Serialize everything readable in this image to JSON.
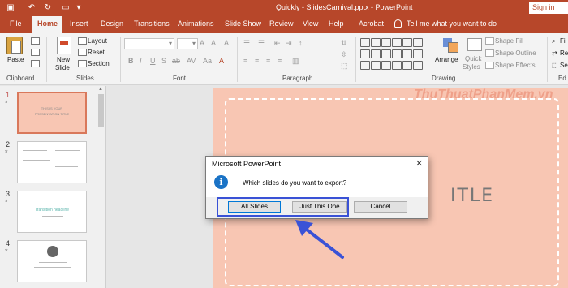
{
  "titlebar": {
    "doc_title": "Quickly - SlidesCarnival.pptx  -  PowerPoint",
    "sign_in": "Sign in",
    "accent_color": "#b7472a"
  },
  "tabs": [
    "File",
    "Home",
    "Insert",
    "Design",
    "Transitions",
    "Animations",
    "Slide Show",
    "Review",
    "View",
    "Help",
    "Acrobat"
  ],
  "tell_me": "Tell me what you want to do",
  "ribbon": {
    "paste": "Paste",
    "new_slide_1": "New",
    "new_slide_2": "Slide",
    "layout": "Layout",
    "reset": "Reset",
    "section": "Section",
    "arrange": "Arrange",
    "quick_styles_1": "Quick",
    "quick_styles_2": "Styles",
    "shape_fill": "Shape Fill",
    "shape_outline": "Shape Outline",
    "shape_effects": "Shape Effects",
    "fi": "Fi",
    "re": "Re",
    "se": "Se",
    "groups": {
      "clipboard": "Clipboard",
      "slides": "Slides",
      "font": "Font",
      "paragraph": "Paragraph",
      "drawing": "Drawing",
      "ed": "Ed"
    }
  },
  "slides": [
    {
      "num": "1",
      "star": "*",
      "line1": "THIS IS YOUR",
      "line2": "PRESENTATION TITLE"
    },
    {
      "num": "2",
      "star": "*"
    },
    {
      "num": "3",
      "star": "*",
      "line1": "Transition headline"
    },
    {
      "num": "4",
      "star": "*"
    }
  ],
  "main_slide": {
    "title_fragment": "ITLE",
    "watermark": "ThuThuatPhanMem.vn"
  },
  "dialog": {
    "title": "Microsoft PowerPoint",
    "close": "✕",
    "info": "i",
    "message": "Which slides do you want to export?",
    "all_slides": "All Slides",
    "just_this_one": "Just This One",
    "cancel": "Cancel"
  }
}
